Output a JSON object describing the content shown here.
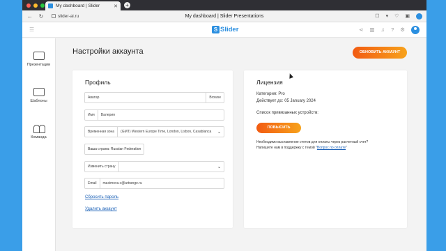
{
  "browser": {
    "tab_title": "My dashboard | Slider",
    "url": "slider-ai.ru",
    "page_title": "My dashboard | Slider Presentations"
  },
  "app": {
    "logo": "Slider"
  },
  "sidebar": {
    "items": [
      {
        "label": "Презентации",
        "icon": "presentation-icon"
      },
      {
        "label": "Шаблоны",
        "icon": "templates-icon"
      },
      {
        "label": "Команда",
        "icon": "team-icon"
      }
    ]
  },
  "page": {
    "title": "Настройки аккаунта",
    "update_button": "ОБНОВИТЬ АККАУНТ"
  },
  "profile": {
    "heading": "Профиль",
    "avatar_label": "Аватар",
    "browse_label": "Browse",
    "name_label": "Имя",
    "name_value": "Валерия",
    "timezone_label": "Временная зона",
    "timezone_value": "(GMT) Western Europe Time, London, Lisbon, Casablanca",
    "country_text": "Ваша страна: Russian Federation",
    "change_country_label": "Изменить страну",
    "change_country_value": "",
    "email_label": "Email",
    "email_value": "maximova.v@artrange.ru",
    "reset_password": "Сбросить пароль",
    "delete_account": "Удалить аккаунт"
  },
  "license": {
    "heading": "Лицензия",
    "category": "Категория: Pro",
    "valid_until": "Действует до: 05 January 2024",
    "devices": "Список привязанных устройств:",
    "raise_button": "ПОВЫСИТЬ",
    "note_line1": "Необходимо выставление счетов для оплаты через расчетный счет?",
    "note_line2_prefix": "Напишите нам в поддержку с темой \"",
    "note_link": "Вопрос по оплате",
    "note_line2_suffix": "\""
  },
  "colors": {
    "accent": "#2b8fe0",
    "button_orange": "#f25b12",
    "link": "#1e63b8"
  }
}
